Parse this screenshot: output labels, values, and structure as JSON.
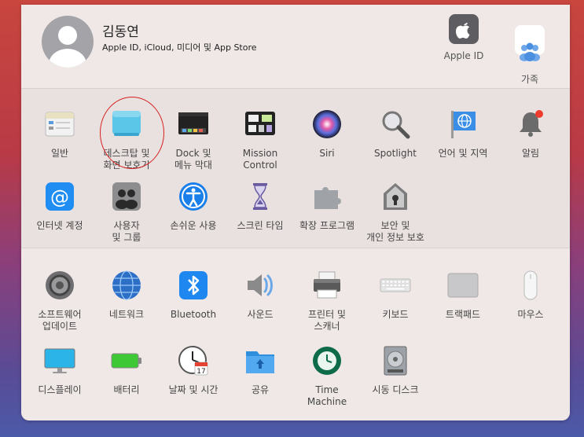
{
  "account": {
    "name": "김동연",
    "subtitle": "Apple ID, iCloud, 미디어 및 App Store"
  },
  "top_items": [
    {
      "label": "Apple ID",
      "icon": "apple-icon"
    },
    {
      "label": "가족\n공유",
      "icon": "family-sharing-icon"
    }
  ],
  "row1": [
    {
      "label": "일반",
      "icon": "general-icon"
    },
    {
      "label": "데스크탑 및\n화면 보호기",
      "icon": "desktop-screensaver-icon"
    },
    {
      "label": "Dock 및\n메뉴 막대",
      "icon": "dock-icon"
    },
    {
      "label": "Mission\nControl",
      "icon": "mission-control-icon"
    },
    {
      "label": "Siri",
      "icon": "siri-icon"
    },
    {
      "label": "Spotlight",
      "icon": "spotlight-icon"
    },
    {
      "label": "언어 및 지역",
      "icon": "language-region-icon"
    },
    {
      "label": "알림",
      "icon": "notifications-icon"
    }
  ],
  "row2": [
    {
      "label": "인터넷 계정",
      "icon": "internet-accounts-icon"
    },
    {
      "label": "사용자\n및 그룹",
      "icon": "users-groups-icon"
    },
    {
      "label": "손쉬운 사용",
      "icon": "accessibility-icon"
    },
    {
      "label": "스크린 타임",
      "icon": "screen-time-icon"
    },
    {
      "label": "확장 프로그램",
      "icon": "extensions-icon"
    },
    {
      "label": "보안 및\n개인 정보 보호",
      "icon": "security-privacy-icon"
    }
  ],
  "row3": [
    {
      "label": "소프트웨어\n업데이트",
      "icon": "software-update-icon"
    },
    {
      "label": "네트워크",
      "icon": "network-icon"
    },
    {
      "label": "Bluetooth",
      "icon": "bluetooth-icon"
    },
    {
      "label": "사운드",
      "icon": "sound-icon"
    },
    {
      "label": "프린터 및\n스캐너",
      "icon": "printer-icon"
    },
    {
      "label": "키보드",
      "icon": "keyboard-icon"
    },
    {
      "label": "트랙패드",
      "icon": "trackpad-icon"
    },
    {
      "label": "마우스",
      "icon": "mouse-icon"
    }
  ],
  "row4": [
    {
      "label": "디스플레이",
      "icon": "display-icon"
    },
    {
      "label": "배터리",
      "icon": "battery-icon"
    },
    {
      "label": "날짜 및 시간",
      "icon": "date-time-icon"
    },
    {
      "label": "공유",
      "icon": "sharing-icon"
    },
    {
      "label": "Time\nMachine",
      "icon": "time-machine-icon"
    },
    {
      "label": "시동 디스크",
      "icon": "startup-disk-icon"
    }
  ],
  "calendar_day": "17"
}
